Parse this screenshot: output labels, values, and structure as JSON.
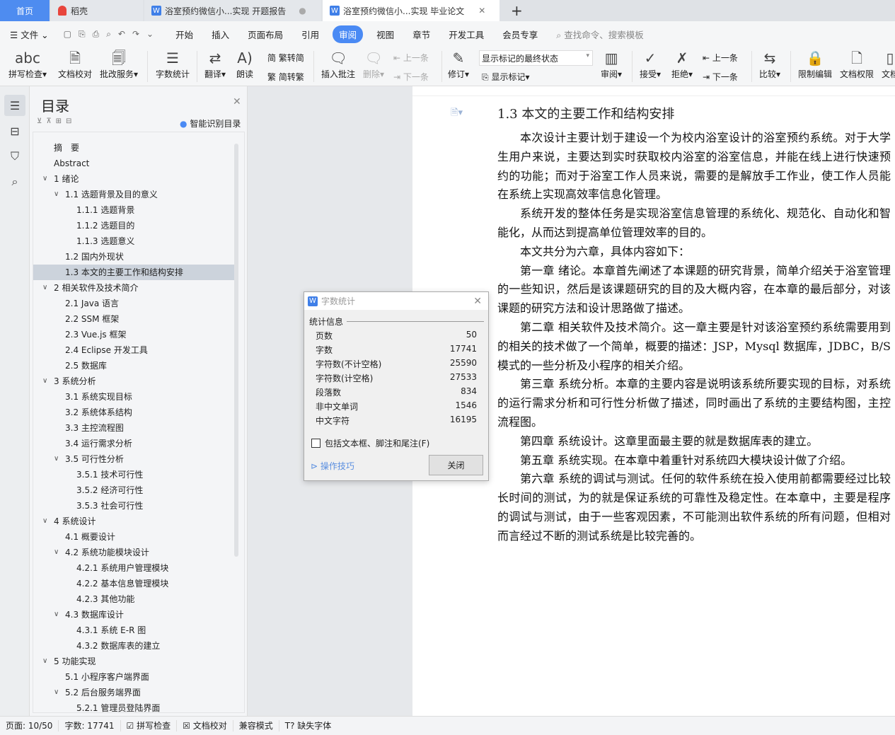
{
  "tabs": {
    "home": "首页",
    "daoke": "稻壳",
    "doc1": "浴室预约微信小...实现 开题报告",
    "doc2": "浴室预约微信小...实现 毕业论文",
    "new_tab": "+"
  },
  "menu": {
    "file": "文件",
    "items": [
      "开始",
      "插入",
      "页面布局",
      "引用",
      "审阅",
      "视图",
      "章节",
      "开发工具",
      "会员专享"
    ],
    "active": "审阅",
    "search": "查找命令、搜索模板"
  },
  "ribbon": {
    "spell": "拼写检查",
    "proof": "文档校对",
    "review_service": "批改服务",
    "word_count": "字数统计",
    "translate": "翻译",
    "read": "朗读",
    "t2s": "繁转简",
    "s2t": "简转繁",
    "insert_comment": "插入批注",
    "delete": "删除",
    "prev": "上一条",
    "next": "下一条",
    "track": "修订",
    "display_select": "显示标记的最终状态",
    "show_marks": "显示标记",
    "review": "审阅",
    "accept": "接受",
    "reject": "拒绝",
    "prev2": "上一条",
    "next2": "下一条",
    "compare": "比较",
    "restrict": "限制编辑",
    "permission": "文档权限",
    "more": "文档"
  },
  "panel": {
    "title": "目录",
    "smart": "智能识别目录"
  },
  "toc": [
    {
      "t": "摘　要",
      "l": 0,
      "c": false
    },
    {
      "t": "Abstract",
      "l": 0,
      "c": false
    },
    {
      "t": "1  绪论",
      "l": 0,
      "c": true
    },
    {
      "t": "1.1  选题背景及目的意义",
      "l": 1,
      "c": true
    },
    {
      "t": "1.1.1  选题背景",
      "l": 2,
      "c": false
    },
    {
      "t": "1.1.2  选题目的",
      "l": 2,
      "c": false
    },
    {
      "t": "1.1.3  选题意义",
      "l": 2,
      "c": false
    },
    {
      "t": "1.2  国内外现状",
      "l": 1,
      "c": false
    },
    {
      "t": "1.3  本文的主要工作和结构安排",
      "l": 1,
      "c": false,
      "sel": true
    },
    {
      "t": "2  相关软件及技术简介",
      "l": 0,
      "c": true
    },
    {
      "t": "2.1 Java 语言",
      "l": 1,
      "c": false
    },
    {
      "t": "2.2 SSM 框架",
      "l": 1,
      "c": false
    },
    {
      "t": "2.3 Vue.js 框架",
      "l": 1,
      "c": false
    },
    {
      "t": "2.4 Eclipse 开发工具",
      "l": 1,
      "c": false
    },
    {
      "t": "2.5 数据库",
      "l": 1,
      "c": false
    },
    {
      "t": "3  系统分析",
      "l": 0,
      "c": true
    },
    {
      "t": "3.1  系统实现目标",
      "l": 1,
      "c": false
    },
    {
      "t": "3.2  系统体系结构",
      "l": 1,
      "c": false
    },
    {
      "t": "3.3  主控流程图",
      "l": 1,
      "c": false
    },
    {
      "t": "3.4  运行需求分析",
      "l": 1,
      "c": false
    },
    {
      "t": "3.5  可行性分析",
      "l": 1,
      "c": true
    },
    {
      "t": "3.5.1 技术可行性",
      "l": 2,
      "c": false
    },
    {
      "t": "3.5.2 经济可行性",
      "l": 2,
      "c": false
    },
    {
      "t": "3.5.3 社会可行性",
      "l": 2,
      "c": false
    },
    {
      "t": "4  系统设计",
      "l": 0,
      "c": true
    },
    {
      "t": "4.1  概要设计",
      "l": 1,
      "c": false
    },
    {
      "t": "4.2  系统功能模块设计",
      "l": 1,
      "c": true
    },
    {
      "t": "4.2.1  系统用户管理模块",
      "l": 2,
      "c": false
    },
    {
      "t": "4.2.2  基本信息管理模块",
      "l": 2,
      "c": false
    },
    {
      "t": "4.2.3  其他功能",
      "l": 2,
      "c": false
    },
    {
      "t": "4.3  数据库设计",
      "l": 1,
      "c": true
    },
    {
      "t": "4.3.1  系统 E-R 图",
      "l": 2,
      "c": false
    },
    {
      "t": "4.3.2  数据库表的建立",
      "l": 2,
      "c": false
    },
    {
      "t": "5  功能实现",
      "l": 0,
      "c": true
    },
    {
      "t": "5.1  小程序客户端界面",
      "l": 1,
      "c": false
    },
    {
      "t": "5.2  后台服务端界面",
      "l": 1,
      "c": true
    },
    {
      "t": "5.2.1  管理员登陆界面",
      "l": 2,
      "c": false
    }
  ],
  "doc": {
    "heading": "1.3  本文的主要工作和结构安排",
    "paragraphs": [
      "本次设计主要计划于建设一个为校内浴室设计的浴室预约系统。对于大学生用户来说，主要达到实时获取校内浴室的浴室信息，并能在线上进行快速预约的功能；而对于浴室工作人员来说，需要的是解放手工作业，使工作人员能在系统上实现高效率信息化管理。",
      "系统开发的整体任务是实现浴室信息管理的系统化、规范化、自动化和智能化，从而达到提高单位管理效率的目的。",
      "本文共分为六章，具体内容如下：",
      "第一章  绪论。本章首先阐述了本课题的研究背景，简单介绍关于浴室管理的一些知识，然后是该课题研究的目的及大概内容，在本章的最后部分，对该课题的研究方法和设计思路做了描述。",
      "第二章  相关软件及技术简介。这一章主要是针对该浴室预约系统需要用到的相关的技术做了一个简单，概要的描述：JSP，Mysql 数据库，JDBC，B/S 模式的一些分析及小程序的相关介绍。",
      "第三章  系统分析。本章的主要内容是说明该系统所要实现的目标，对系统的运行需求分析和可行性分析做了描述，同时画出了系统的主要结构图，主控流程图。",
      "第四章  系统设计。这章里面最主要的就是数据库表的建立。",
      "第五章  系统实现。在本章中着重针对系统四大模块设计做了介绍。",
      "第六章  系统的调试与测试。任何的软件系统在投入使用前都需要经过比较长时间的测试，为的就是保证系统的可靠性及稳定性。在本章中，主要是程序的调试与测试，由于一些客观因素，不可能测出软件系统的所有问题，但相对而言经过不断的测试系统是比较完善的。"
    ]
  },
  "dialog": {
    "title": "字数统计",
    "group": "统计信息",
    "rows": [
      {
        "label": "页数",
        "value": "50"
      },
      {
        "label": "字数",
        "value": "17741"
      },
      {
        "label": "字符数(不计空格)",
        "value": "25590"
      },
      {
        "label": "字符数(计空格)",
        "value": "27533"
      },
      {
        "label": "段落数",
        "value": "834"
      },
      {
        "label": "非中文单词",
        "value": "1546"
      },
      {
        "label": "中文字符",
        "value": "16195"
      }
    ],
    "checkbox": "包括文本框、脚注和尾注(F)",
    "tips": "操作技巧",
    "close": "关闭"
  },
  "status": {
    "page": "页面: 10/50",
    "words": "字数: 17741",
    "spell": "拼写检查",
    "proof": "文档校对",
    "compat": "兼容模式",
    "missing_font": "缺失字体"
  }
}
